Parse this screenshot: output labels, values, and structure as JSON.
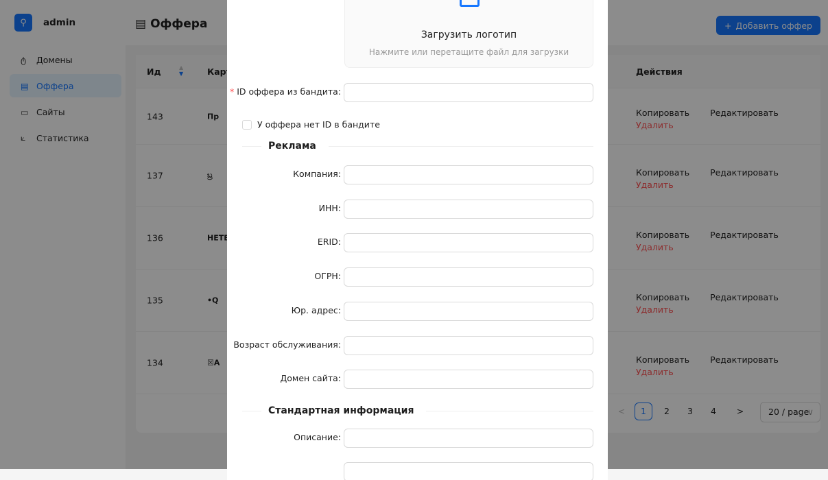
{
  "user": {
    "name": "admin",
    "avatar_icon": "user-icon"
  },
  "nav": [
    {
      "label": "Домены",
      "icon": "ტ"
    },
    {
      "label": "Оффера",
      "icon": "▤",
      "active": true
    },
    {
      "label": "Сайты",
      "icon": "▭"
    },
    {
      "label": "Статистика",
      "icon": "⟀"
    }
  ],
  "header": {
    "title": "Оффера",
    "add_label": "Добавить оффер"
  },
  "table": {
    "columns": [
      "Ид",
      "Карти",
      "Действия"
    ],
    "rows": [
      {
        "id": "143",
        "thumb": "Пр"
      },
      {
        "id": "137",
        "thumb": "ಬ್ರ"
      },
      {
        "id": "136",
        "thumb": "HETB"
      },
      {
        "id": "135",
        "thumb": "•Q"
      },
      {
        "id": "134",
        "thumb": "☒А"
      }
    ],
    "actions": {
      "copy": "Копировать",
      "edit": "Редактировать",
      "delete": "Удалить"
    }
  },
  "pagination": {
    "prev": "<",
    "pages": [
      "1",
      "2",
      "3",
      "4"
    ],
    "next": ">",
    "current": "1",
    "size": "20 / page"
  },
  "modal": {
    "upload_title": "Загрузить логотип",
    "upload_hint": "Нажмите или перетащите файл для загрузки",
    "bandit_id_label": "ID оффера из бандита",
    "no_id_label": "У оффера нет ID в бандите",
    "section_ads": "Реклама",
    "ads_fields": [
      "Компания",
      "ИНН",
      "ERID",
      "ОГРН",
      "Юр. адрес",
      "Возраст обслуживания",
      "Домен сайта"
    ],
    "section_std": "Стандартная информация",
    "std_fields": [
      "Описание"
    ]
  }
}
